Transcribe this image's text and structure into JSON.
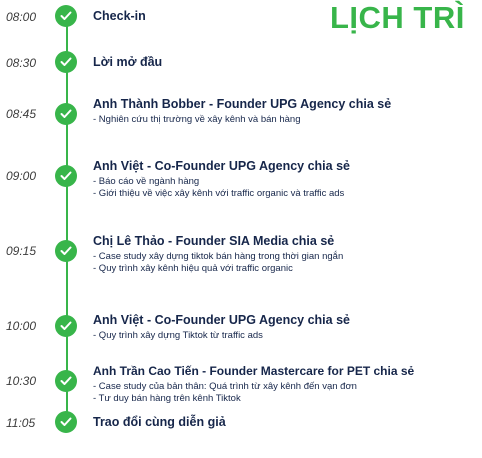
{
  "title": "LỊCH TRÌ",
  "accent_color": "#38b54a",
  "text_color": "#16264a",
  "items": [
    {
      "time": "08:00",
      "title": "Check-in",
      "details": []
    },
    {
      "time": "08:30",
      "title": "Lời mở đầu",
      "details": []
    },
    {
      "time": "08:45",
      "title": "Anh Thành Bobber - Founder UPG Agency chia sẻ",
      "details": [
        "- Nghiên cứu thị trường về xây kênh và bán hàng"
      ]
    },
    {
      "time": "09:00",
      "title": "Anh Việt - Co-Founder UPG Agency chia sẻ",
      "details": [
        "- Báo cáo về ngành hàng",
        "- Giới thiệu về việc xây kênh với traffic organic và traffic ads"
      ]
    },
    {
      "time": "09:15",
      "title": "Chị Lê Thảo - Founder SIA Media chia sẻ",
      "details": [
        "- Case study xây dựng tiktok bán hàng trong thời gian ngắn",
        "- Quy trình xây kênh hiệu quả với traffic organic"
      ]
    },
    {
      "time": "10:00",
      "title": "Anh Việt - Co-Founder UPG Agency chia sẻ",
      "details": [
        "- Quy trình xây dựng Tiktok từ traffic ads"
      ]
    },
    {
      "time": "10:30",
      "title": "Anh Trần Cao Tiến - Founder Mastercare for PET chia sẻ",
      "details": [
        "- Case study của bản thân: Quá trình từ xây kênh đến vạn đơn",
        "- Tư duy bán hàng trên kênh Tiktok"
      ]
    },
    {
      "time": "11:05",
      "title": "Trao đổi cùng diễn giả",
      "details": []
    }
  ]
}
